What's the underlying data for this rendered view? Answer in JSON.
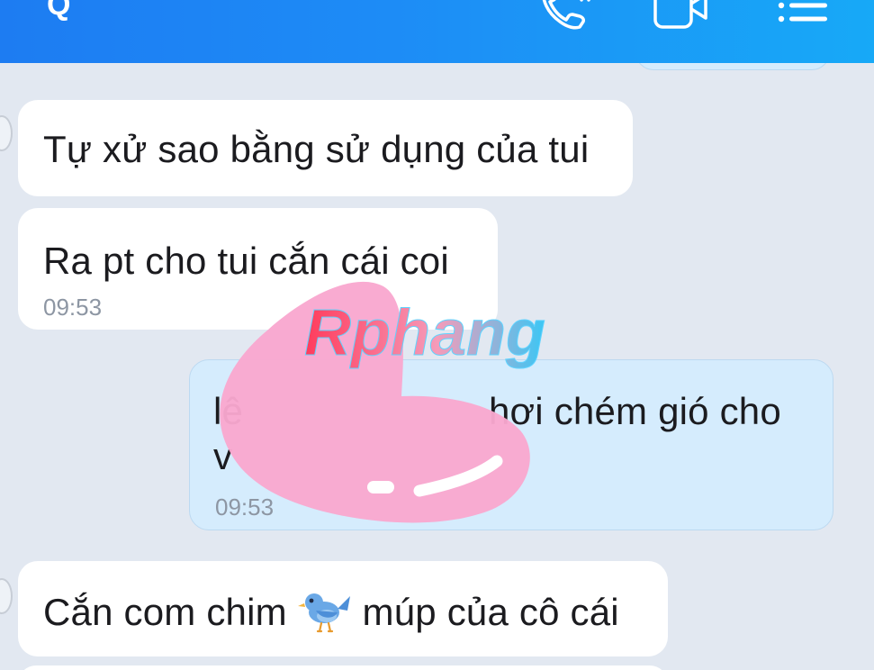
{
  "header": {
    "icons": [
      "search-icon",
      "phone-call-icon",
      "video-call-icon",
      "menu-list-icon"
    ],
    "left_glyph": "Q",
    "colors": {
      "start": "#1d7cf2",
      "end": "#17a9f7"
    }
  },
  "messages": [
    {
      "direction": "incoming",
      "text": "Tự xử sao bằng sử dụng của tui",
      "time": ""
    },
    {
      "direction": "incoming",
      "text": "Ra pt cho tui cắn cái coi",
      "time": "09:53"
    },
    {
      "direction": "outgoing",
      "text_start": "lê",
      "text_end": "hơi chém gió cho",
      "line2": "v",
      "time": "09:53"
    },
    {
      "direction": "incoming",
      "text_before_emoji": "Cắn com chim ",
      "emoji": "bird-emoji",
      "text_after_emoji": " múp của cô cái",
      "time": ""
    }
  ],
  "watermark": {
    "text": "Rphang",
    "sticker": "pink-heart-sticker",
    "colors": {
      "heart": "#f9a8cf",
      "logo_start": "#ff3b5c",
      "logo_end": "#3ac7f5"
    }
  },
  "colors": {
    "background": "#e2e8f1",
    "incoming_bubble": "#ffffff",
    "outgoing_bubble": "#d5ecfd"
  }
}
